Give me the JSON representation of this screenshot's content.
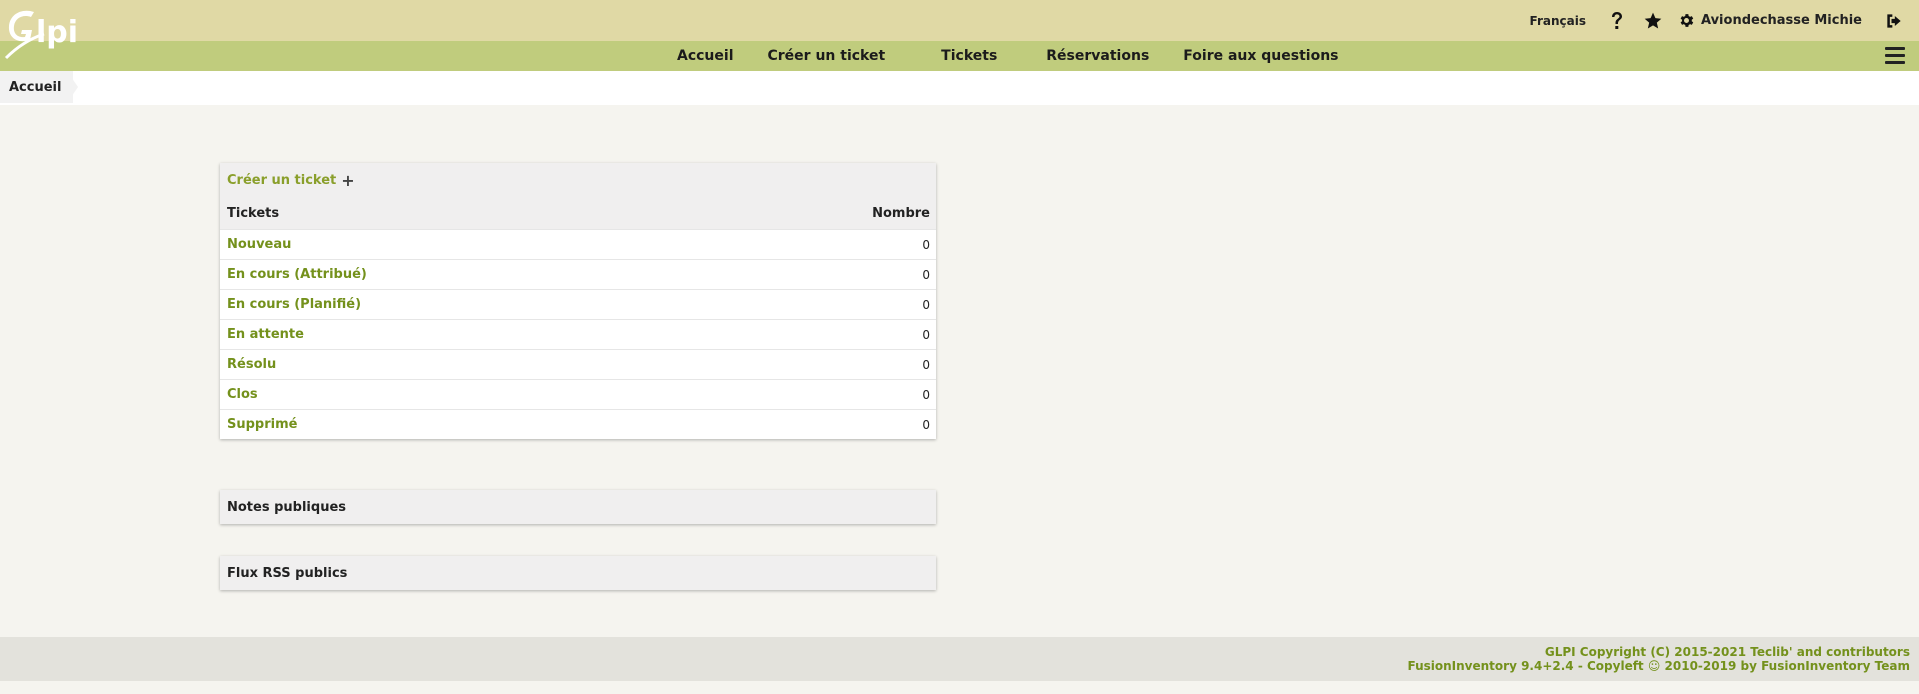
{
  "header": {
    "logo_text": "Glpi",
    "language": "Français",
    "help_icon": "question-icon",
    "favorites_icon": "star-icon",
    "settings_icon": "gear-icon",
    "user_name": "Aviondechasse Michie",
    "logout_icon": "logout-icon"
  },
  "nav": {
    "items": [
      {
        "label": "Accueil"
      },
      {
        "label": "Créer un ticket"
      },
      {
        "label": "Tickets"
      },
      {
        "label": "Réservations"
      },
      {
        "label": "Foire aux questions"
      }
    ],
    "menu_icon": "hamburger-icon"
  },
  "breadcrumb": {
    "current": "Accueil"
  },
  "tickets_panel": {
    "create_label": "Créer un ticket",
    "plus": "+",
    "col_tickets": "Tickets",
    "col_count": "Nombre",
    "rows": [
      {
        "label": "Nouveau",
        "count": "0"
      },
      {
        "label": "En cours (Attribué)",
        "count": "0"
      },
      {
        "label": "En cours (Planifié)",
        "count": "0"
      },
      {
        "label": "En attente",
        "count": "0"
      },
      {
        "label": "Résolu",
        "count": "0"
      },
      {
        "label": "Clos",
        "count": "0"
      },
      {
        "label": "Supprimé",
        "count": "0"
      }
    ]
  },
  "notes_panel": {
    "title": "Notes publiques"
  },
  "rss_panel": {
    "title": "Flux RSS publics"
  },
  "footer": {
    "line1": "GLPI Copyright (C) 2015-2021 Teclib' and contributors",
    "line2": "FusionInventory 9.4+2.4 - Copyleft ☺ 2010-2019 by FusionInventory Team"
  },
  "colors": {
    "topbar": "#e0d9a5",
    "navbar": "#c0cc7d",
    "link_green": "#74911c",
    "background": "#f5f4ef"
  }
}
